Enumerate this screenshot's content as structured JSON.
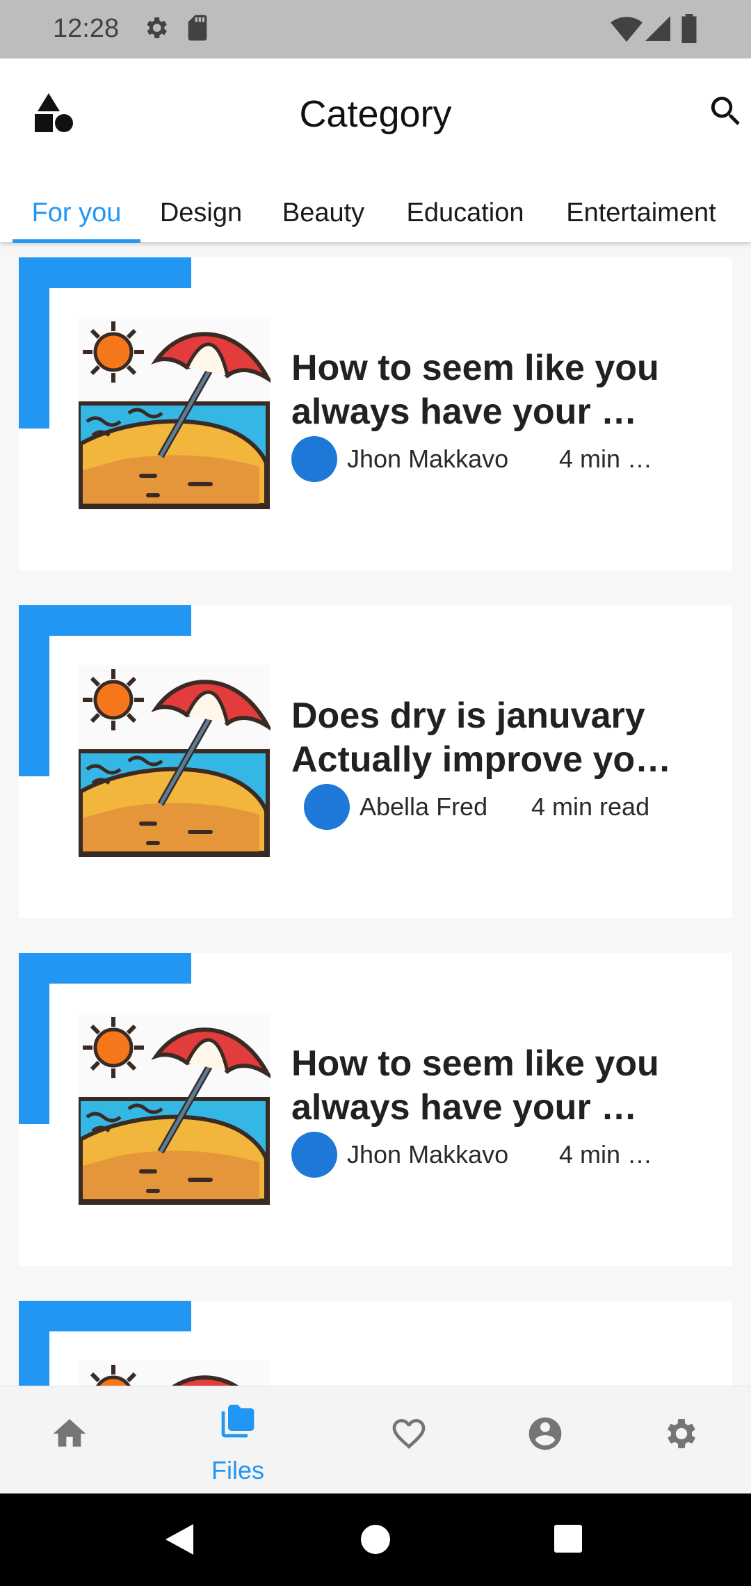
{
  "status_bar": {
    "time": "12:28",
    "icons_left": [
      "gear-icon",
      "sd-card-icon"
    ],
    "icons_right": [
      "wifi-icon",
      "signal-icon",
      "battery-icon"
    ]
  },
  "app_bar": {
    "logo": "shapes-icon",
    "title": "Category",
    "search_icon": "search-icon"
  },
  "tabs": [
    {
      "label": "For you",
      "active": true
    },
    {
      "label": "Design",
      "active": false
    },
    {
      "label": "Beauty",
      "active": false
    },
    {
      "label": "Education",
      "active": false
    },
    {
      "label": "Entertaiment",
      "active": false
    }
  ],
  "articles": [
    {
      "title_line1": "How to seem like you",
      "title_line2": "always have your …",
      "author": "Jhon Makkavo",
      "read_time": "4 min …",
      "thumbnail": "beach-umbrella-image"
    },
    {
      "title_line1": "Does dry is januvary",
      "title_line2": "Actually improve yo…",
      "author": "Abella Fred",
      "read_time": "4 min read",
      "thumbnail": "beach-umbrella-image"
    },
    {
      "title_line1": "How to seem like you",
      "title_line2": "always have your …",
      "author": "Jhon Makkavo",
      "read_time": "4 min …",
      "thumbnail": "beach-umbrella-image"
    }
  ],
  "bottom_nav": [
    {
      "icon": "home-icon",
      "label": "",
      "active": false
    },
    {
      "icon": "folder-icon",
      "label": "Files",
      "active": true
    },
    {
      "icon": "heart-icon",
      "label": "",
      "active": false
    },
    {
      "icon": "account-icon",
      "label": "",
      "active": false
    },
    {
      "icon": "settings-icon",
      "label": "",
      "active": false
    }
  ],
  "colors": {
    "accent": "#2196f3",
    "avatar": "#1e78d8",
    "inactive_icon": "#757575",
    "status_bar": "#bdbdbd"
  }
}
